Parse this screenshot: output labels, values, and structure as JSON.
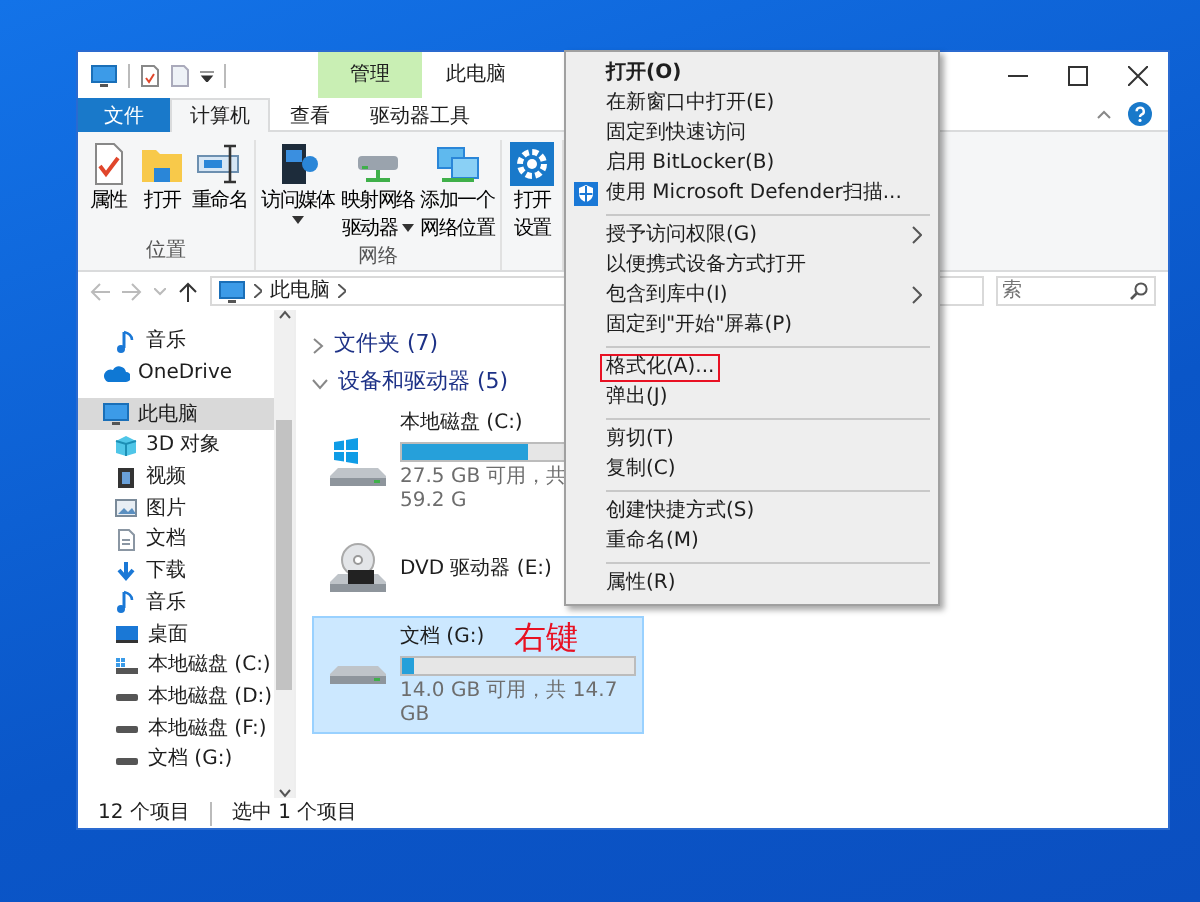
{
  "window": {
    "title": "此电脑",
    "context_tab": "管理"
  },
  "ribbon_tabs": [
    {
      "label": "文件",
      "kind": "file",
      "selected": false
    },
    {
      "label": "计算机",
      "kind": "tab",
      "selected": true
    },
    {
      "label": "查看",
      "kind": "tab",
      "selected": false
    },
    {
      "label": "驱动器工具",
      "kind": "tab",
      "selected": false
    }
  ],
  "ribbon_groups": [
    {
      "label": "位置",
      "buttons": [
        {
          "kind": "properties",
          "lines": [
            "属性"
          ],
          "dropdown": false
        },
        {
          "kind": "open",
          "lines": [
            "打开"
          ],
          "dropdown": false
        },
        {
          "kind": "rename",
          "lines": [
            "重命名"
          ],
          "dropdown": false
        }
      ]
    },
    {
      "label": "网络",
      "buttons": [
        {
          "kind": "media",
          "lines": [
            "访问媒体"
          ],
          "dropdown": true
        },
        {
          "kind": "map-drive",
          "lines": [
            "映射网络",
            "驱动器"
          ],
          "dropdown": true
        },
        {
          "kind": "add-location",
          "lines": [
            "添加一个",
            "网络位置"
          ],
          "dropdown": false
        }
      ]
    },
    {
      "buttons": [
        {
          "kind": "settings",
          "lines": [
            "打开",
            "设置"
          ],
          "dropdown": false
        }
      ]
    }
  ],
  "address": {
    "path": "此电脑"
  },
  "search": {
    "placeholder": "索"
  },
  "nav": [
    {
      "label": "音乐",
      "kind": "music",
      "selected": false
    },
    {
      "label": "OneDrive",
      "kind": "cloud",
      "selected": false
    },
    {
      "label": "此电脑",
      "kind": "pc",
      "selected": true,
      "children": [
        {
          "label": "3D 对象",
          "kind": "cube",
          "selected": false
        },
        {
          "label": "视频",
          "kind": "video",
          "selected": false
        },
        {
          "label": "图片",
          "kind": "picture",
          "selected": false
        },
        {
          "label": "文档",
          "kind": "document",
          "selected": false
        },
        {
          "label": "下载",
          "kind": "download",
          "selected": false
        },
        {
          "label": "音乐",
          "kind": "music",
          "selected": false
        },
        {
          "label": "桌面",
          "kind": "desktop",
          "selected": false
        },
        {
          "label": "本地磁盘 (C:)",
          "kind": "system-drive",
          "selected": false
        },
        {
          "label": "本地磁盘 (D:)",
          "kind": "drive",
          "selected": false
        },
        {
          "label": "本地磁盘 (F:)",
          "kind": "drive",
          "selected": false
        },
        {
          "label": "文档 (G:)",
          "kind": "drive",
          "selected": false
        }
      ]
    }
  ],
  "sections": [
    {
      "label": "文件夹 (7)",
      "expanded": false
    },
    {
      "label": "设备和驱动器 (5)",
      "expanded": true,
      "drives": [
        {
          "name": "本地磁盘 (C:)",
          "kind": "system",
          "level": 0.54,
          "space": "27.5 GB 可用，共 59.2 G",
          "selected": false
        },
        {
          "name": "DVD 驱动器 (E:)",
          "kind": "dvd",
          "selected": false
        },
        {
          "name": "文档 (G:)",
          "kind": "disk",
          "level": 0.05,
          "space": "14.0 GB 可用，共 14.7 GB",
          "selected": true
        }
      ]
    }
  ],
  "status_bar": {
    "count": "12 个项目",
    "selection": "选中 1 个项目"
  },
  "context_menu": [
    {
      "kind": "item",
      "label": "打开(O)",
      "default": true,
      "submenu": false,
      "highlighted": false
    },
    {
      "kind": "item",
      "label": "在新窗口中打开(E)",
      "default": false,
      "submenu": false,
      "highlighted": false
    },
    {
      "kind": "item",
      "label": "固定到快速访问",
      "default": false,
      "submenu": false,
      "highlighted": false
    },
    {
      "kind": "item",
      "label": "启用 BitLocker(B)",
      "default": false,
      "submenu": false,
      "highlighted": false
    },
    {
      "kind": "shield",
      "label": "使用 Microsoft Defender扫描...",
      "default": false,
      "submenu": false,
      "highlighted": false
    },
    {
      "kind": "separator"
    },
    {
      "kind": "item",
      "label": "授予访问权限(G)",
      "default": false,
      "submenu": true,
      "highlighted": false
    },
    {
      "kind": "item",
      "label": "以便携式设备方式打开",
      "default": false,
      "submenu": false,
      "highlighted": false
    },
    {
      "kind": "item",
      "label": "包含到库中(I)",
      "default": false,
      "submenu": true,
      "highlighted": false
    },
    {
      "kind": "item",
      "label": "固定到\"开始\"屏幕(P)",
      "default": false,
      "submenu": false,
      "highlighted": false
    },
    {
      "kind": "separator"
    },
    {
      "kind": "item",
      "label": "格式化(A)...",
      "default": false,
      "submenu": false,
      "highlighted": true
    },
    {
      "kind": "item",
      "label": "弹出(J)",
      "default": false,
      "submenu": false,
      "highlighted": false
    },
    {
      "kind": "separator"
    },
    {
      "kind": "item",
      "label": "剪切(T)",
      "default": false,
      "submenu": false,
      "highlighted": false
    },
    {
      "kind": "item",
      "label": "复制(C)",
      "default": false,
      "submenu": false,
      "highlighted": false
    },
    {
      "kind": "separator"
    },
    {
      "kind": "item",
      "label": "创建快捷方式(S)",
      "default": false,
      "submenu": false,
      "highlighted": false
    },
    {
      "kind": "item",
      "label": "重命名(M)",
      "default": false,
      "submenu": false,
      "highlighted": false
    },
    {
      "kind": "separator"
    },
    {
      "kind": "item",
      "label": "属性(R)",
      "default": false,
      "submenu": false,
      "highlighted": false
    }
  ],
  "annotation": {
    "text": "右键"
  }
}
